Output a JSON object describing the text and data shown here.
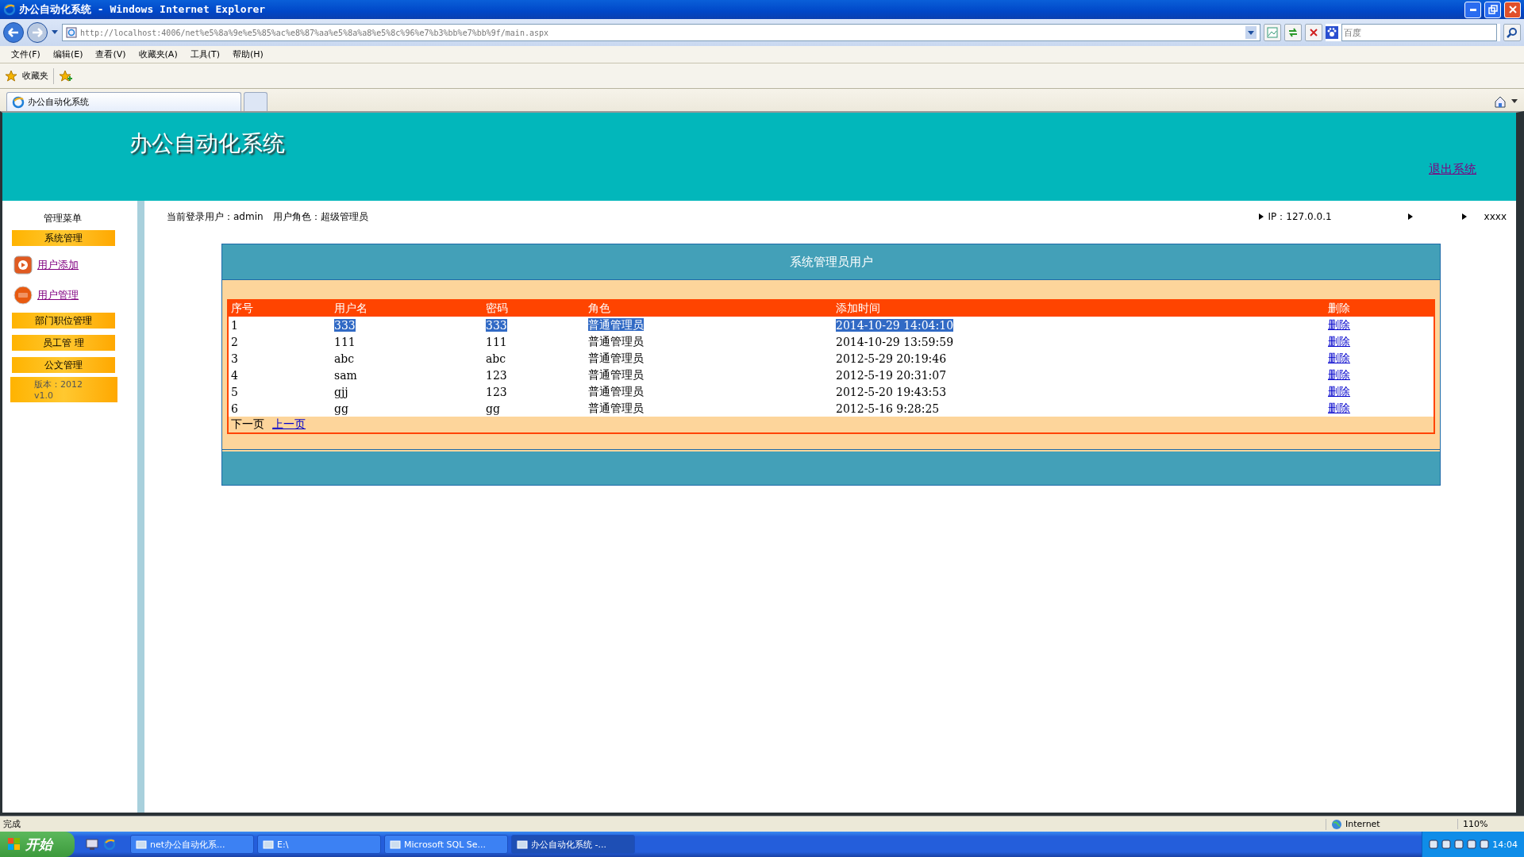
{
  "window": {
    "title": "办公自动化系统 - Windows Internet Explorer"
  },
  "address_bar": {
    "url": "http://localhost:4006/net%e5%8a%9e%e5%85%ac%e8%87%aa%e5%8a%a8%e5%8c%96%e7%b3%bb%e7%bb%9f/main.aspx"
  },
  "search_box": {
    "placeholder": "百度"
  },
  "menu": [
    "文件(F)",
    "编辑(E)",
    "查看(V)",
    "收藏夹(A)",
    "工具(T)",
    "帮助(H)"
  ],
  "favorites_bar": {
    "label": "收藏夹"
  },
  "tabs": [
    {
      "label": "办公自动化系统",
      "selected": true
    },
    {
      "selected": false
    }
  ],
  "header": {
    "title": "办公自动化系统",
    "logout": "退出系统"
  },
  "info": {
    "user_line": "当前登录用户：admin　用户角色：超级管理员",
    "ip": "IP：127.0.0.1",
    "extra": "xxxx"
  },
  "sidebar": {
    "heading": "管理菜单",
    "items": [
      {
        "kind": "section",
        "label": "系统管理"
      },
      {
        "kind": "link",
        "label": "用户添加"
      },
      {
        "kind": "link",
        "label": "用户管理"
      },
      {
        "kind": "section",
        "label": "部门职位管理"
      },
      {
        "kind": "section",
        "label": "员工管 理"
      },
      {
        "kind": "section",
        "label": "公文管理"
      }
    ],
    "version": [
      "版本：2012",
      "v1.0"
    ]
  },
  "panel": {
    "title": "系统管理员用户",
    "columns": [
      "序号",
      "用户名",
      "密码",
      "角色",
      "添加时间",
      "删除"
    ],
    "rows": [
      {
        "cells": [
          "1",
          "333",
          "333",
          "普通管理员",
          "2014-10-29 14:04:10",
          "删除"
        ],
        "selected": true
      },
      {
        "cells": [
          "2",
          "111",
          "111",
          "普通管理员",
          "2014-10-29 13:59:59",
          "删除"
        ],
        "selected": false
      },
      {
        "cells": [
          "3",
          "abc",
          "abc",
          "普通管理员",
          "2012-5-29 20:19:46",
          "删除"
        ],
        "selected": false
      },
      {
        "cells": [
          "4",
          "sam",
          "123",
          "普通管理员",
          "2012-5-19 20:31:07",
          "删除"
        ],
        "selected": false
      },
      {
        "cells": [
          "5",
          "gjj",
          "123",
          "普通管理员",
          "2012-5-20 19:43:53",
          "删除"
        ],
        "selected": false
      },
      {
        "cells": [
          "6",
          "gg",
          "gg",
          "普通管理员",
          "2012-5-16 9:28:25",
          "删除"
        ],
        "selected": false
      }
    ],
    "pager": [
      {
        "kind": "text",
        "label": "下一页"
      },
      {
        "kind": "link",
        "label": "上一页"
      }
    ]
  },
  "status_bar": {
    "text": "完成",
    "zone": "Internet",
    "zoom": "110%"
  },
  "taskbar": {
    "start": "开始",
    "tasks": [
      {
        "label": "net办公自动化系...",
        "selected": false
      },
      {
        "label": "E:\\",
        "selected": false
      },
      {
        "label": "Microsoft SQL Se...",
        "selected": false
      },
      {
        "label": "办公自动化系统 -...",
        "selected": true
      }
    ],
    "clock": "14:04"
  }
}
